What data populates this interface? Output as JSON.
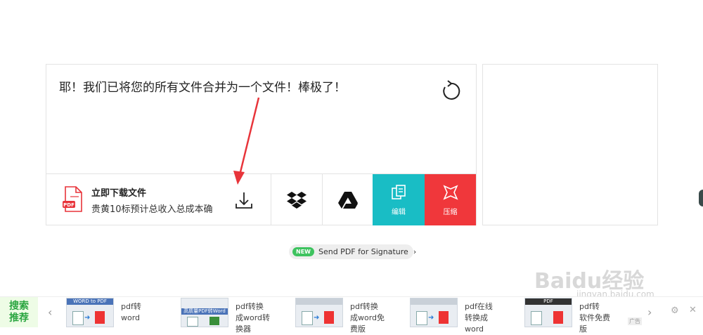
{
  "result": {
    "message": "耶！我们已将您的所有文件合并为一个文件！棒极了！"
  },
  "download": {
    "title": "立即下载文件",
    "subtitle": "贵黄10标预计总收入总成本确",
    "pdf_badge": "PDF"
  },
  "tools": {
    "edit_label": "编辑",
    "compress_label": "压缩"
  },
  "signature": {
    "badge": "NEW",
    "label": "Send PDF for Signature",
    "arrow": "›"
  },
  "recommend": {
    "label_line1": "搜索",
    "label_line2": "推荐",
    "prev": "‹",
    "next": "›",
    "ad_label": "广告",
    "items": [
      {
        "thumb_title": "WORD to PDF",
        "caption": "pdf转\nword"
      },
      {
        "thumb_title": "高质量PDF转Word",
        "caption": "pdf转换\n成word转\n换器"
      },
      {
        "thumb_title": "",
        "caption": "pdf转换\n成word免\n费版"
      },
      {
        "thumb_title": "",
        "caption": "pdf在线\n转换成\nword"
      },
      {
        "thumb_title": "PDF",
        "caption": "pdf转\n软件免费\n版"
      }
    ]
  },
  "watermark": {
    "brand": "Baidu经验",
    "url": "jingyan.baidu.com"
  },
  "colors": {
    "edit": "#19bdc5",
    "compress": "#f0373b",
    "new_badge": "#3ec35f",
    "annotation_arrow": "#e8343a"
  }
}
